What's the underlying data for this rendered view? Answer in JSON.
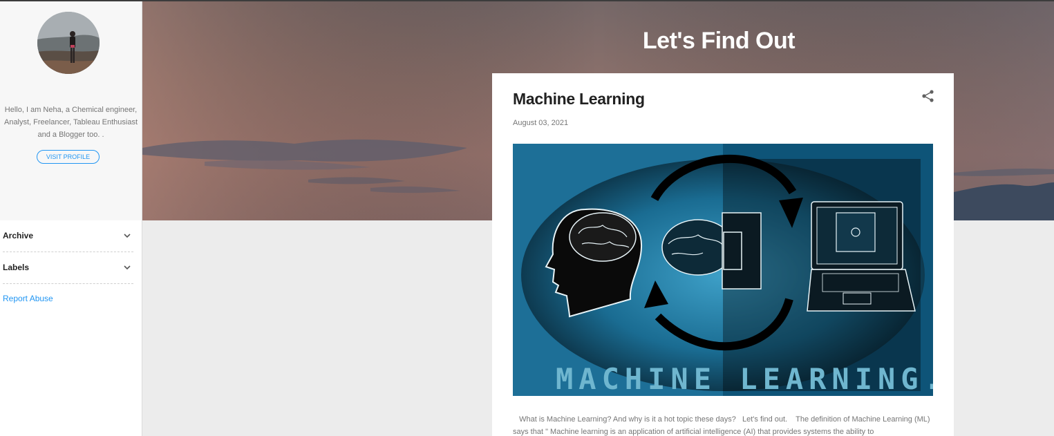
{
  "profile": {
    "bio": "Hello, I am Neha, a Chemical engineer, Analyst, Freelancer, Tableau Enthusiast and a Blogger too. .",
    "visit_label": "VISIT PROFILE"
  },
  "sidebar": {
    "sections": [
      {
        "label": "Archive",
        "icon": "chevron-down-icon"
      },
      {
        "label": "Labels",
        "icon": "chevron-down-icon"
      }
    ],
    "report_label": "Report Abuse"
  },
  "blog": {
    "title": "Let's Find Out"
  },
  "post": {
    "title": "Machine Learning",
    "date": "August 03, 2021",
    "share_icon": "share-icon",
    "image_caption": "MACHINE  LEARNING...",
    "excerpt": "   What is Machine Learning? And why is it a hot topic these days?   Let's find out.    The definition of Machine Learning (ML) says that \" Machine learning is an application of artificial intelligence (AI) that provides systems the ability to"
  },
  "colors": {
    "accent": "#2196f3",
    "title_text": "#212121",
    "muted_text": "#757575",
    "page_bg": "#ececec"
  }
}
